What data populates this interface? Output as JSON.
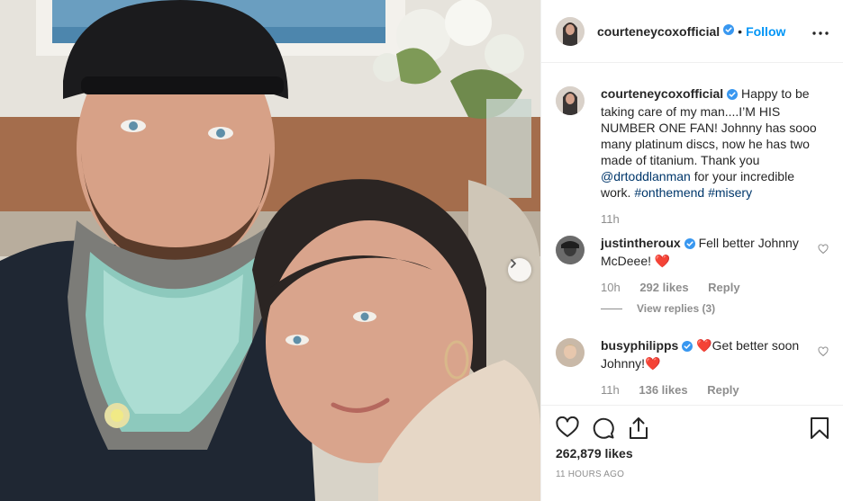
{
  "post": {
    "username": "courteneycoxofficial",
    "follow_label": "Follow",
    "dot": "•",
    "caption": {
      "username": "courteneycoxofficial",
      "text_1": "Happy to be taking care of my man....I’M HIS NUMBER ONE FAN! Johnny has sooo many platinum discs, now he has two made of titanium. Thank you ",
      "mention": "@drtoddlanman",
      "text_2": " for your incredible work. ",
      "tag_1": "#onthemend",
      "tag_2": "#misery",
      "time": "11h"
    },
    "comments": [
      {
        "username": "justintheroux",
        "text": "Fell better Johnny McDeee!",
        "emoji": "❤️",
        "time": "10h",
        "likes": "292 likes",
        "reply_label": "Reply",
        "view_replies": "View replies (3)"
      },
      {
        "username": "busyphilipps",
        "emoji_prefix": "❤️",
        "text": "Get better soon Johnny!",
        "emoji": "❤️",
        "time": "11h",
        "likes": "136 likes",
        "reply_label": "Reply"
      }
    ],
    "likes_count": "262,879 likes",
    "timestamp": "11 HOURS AGO"
  },
  "colors": {
    "link": "#00376b",
    "follow": "#0095f6",
    "verified": "#3897f0",
    "muted": "#8e8e8e"
  },
  "icons": [
    "verified-badge-icon",
    "more-options-icon",
    "heart-icon",
    "comment-icon",
    "share-icon",
    "bookmark-icon",
    "chevron-right-icon"
  ]
}
